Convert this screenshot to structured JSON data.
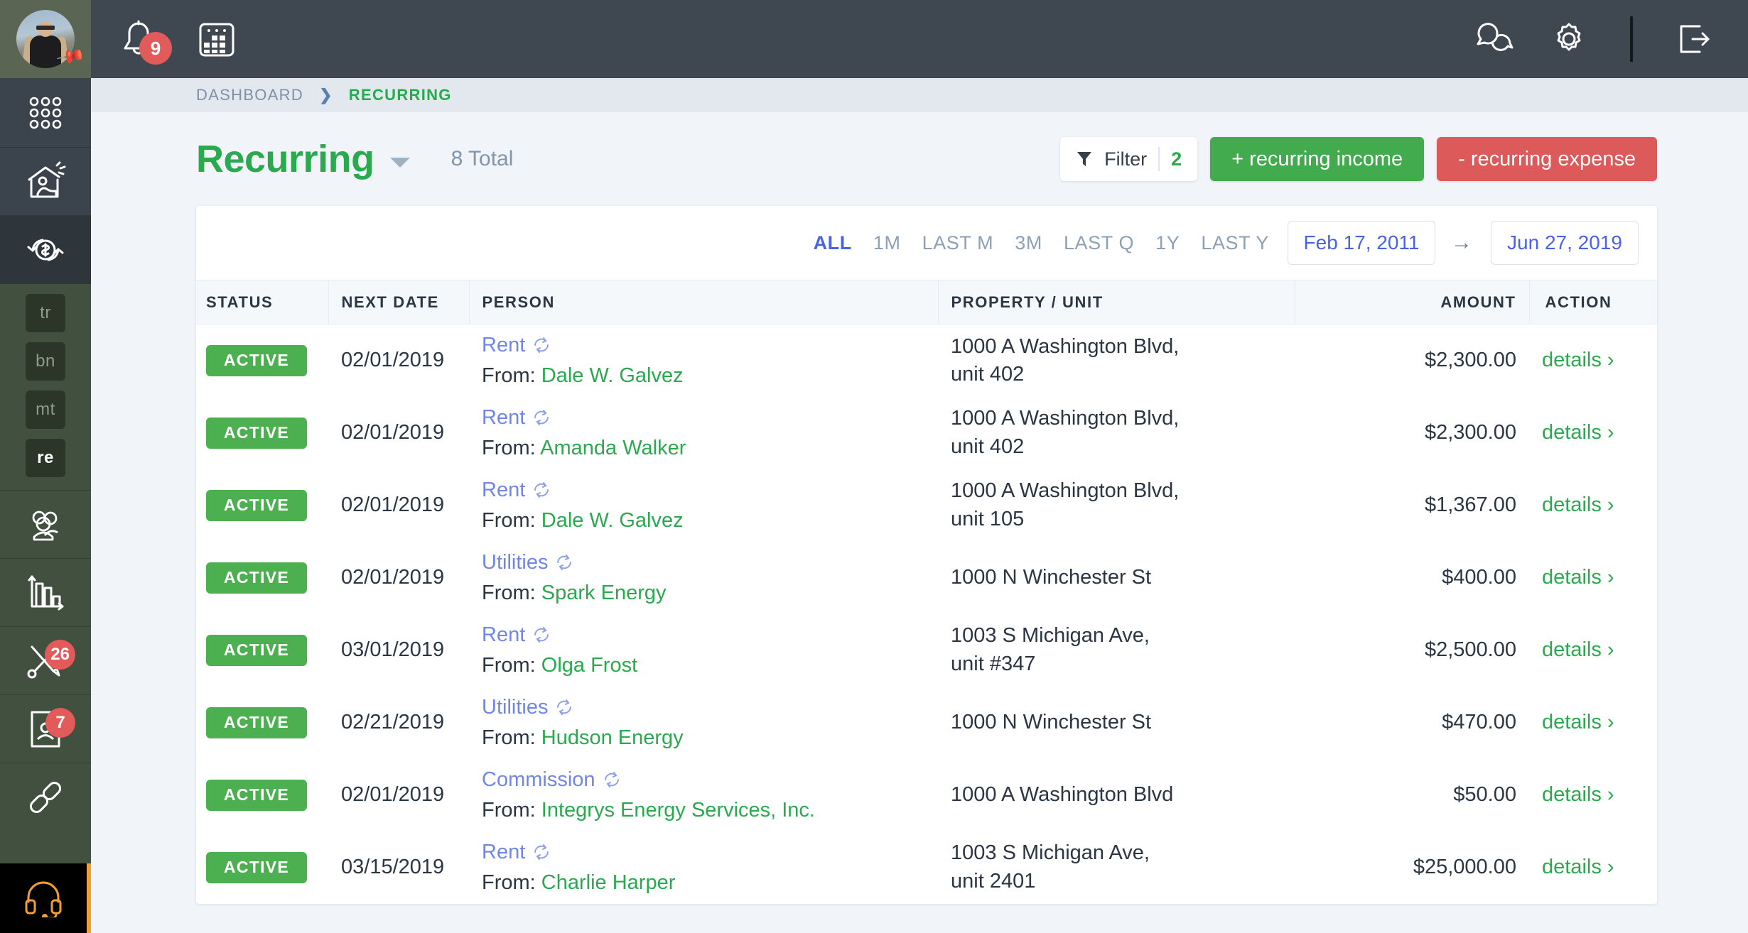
{
  "colors": {
    "brand_green": "#2aa94f",
    "accent_blue": "#4a62e8",
    "danger_red": "#dd5a5a",
    "sidebar_green": "#41503f",
    "topbar_dark": "#3f4850"
  },
  "sidebar": {
    "avatar_name": "user-avatar",
    "pin_icon": "pin-icon",
    "items": [
      {
        "name": "apps-grid-icon",
        "label": ""
      },
      {
        "name": "property-icon",
        "label": ""
      },
      {
        "name": "recurring-icon",
        "label": ""
      }
    ],
    "sub_items": [
      {
        "label": "tr",
        "active": false
      },
      {
        "label": "bn",
        "active": false
      },
      {
        "label": "mt",
        "active": false
      },
      {
        "label": "re",
        "active": true
      }
    ],
    "lower_items": [
      {
        "name": "people-icon",
        "badge": ""
      },
      {
        "name": "reports-bar-chart-icon",
        "badge": ""
      },
      {
        "name": "maintenance-tools-icon",
        "badge": "26"
      },
      {
        "name": "applications-doc-icon",
        "badge": "7"
      },
      {
        "name": "link-chain-icon",
        "badge": ""
      }
    ],
    "support": {
      "name": "headset-support-icon"
    }
  },
  "topbar": {
    "left_icons": [
      {
        "name": "notifications-bell-icon",
        "badge": "9"
      },
      {
        "name": "calendar-icon",
        "badge": ""
      }
    ],
    "right_icons": [
      {
        "name": "chat-bubbles-icon"
      },
      {
        "name": "gear-settings-icon"
      },
      {
        "name": "logout-icon"
      }
    ]
  },
  "breadcrumb": {
    "parent": "DASHBOARD",
    "separator": "❯",
    "current": "RECURRING"
  },
  "page": {
    "title": "Recurring",
    "total_label": "8 Total"
  },
  "actions": {
    "filter_label": "Filter",
    "filter_count": "2",
    "add_income": "+ recurring income",
    "add_expense": "- recurring expense"
  },
  "range": {
    "presets": [
      {
        "label": "ALL",
        "active": true
      },
      {
        "label": "1M",
        "active": false
      },
      {
        "label": "LAST M",
        "active": false
      },
      {
        "label": "3M",
        "active": false
      },
      {
        "label": "LAST Q",
        "active": false
      },
      {
        "label": "1Y",
        "active": false
      },
      {
        "label": "LAST Y",
        "active": false
      }
    ],
    "start_date": "Feb 17, 2011",
    "arrow": "→",
    "end_date": "Jun 27, 2019"
  },
  "table": {
    "columns": [
      "STATUS",
      "NEXT DATE",
      "PERSON",
      "PROPERTY / UNIT",
      "AMOUNT",
      "ACTION"
    ],
    "from_prefix": "From:",
    "details_label": "details",
    "details_chevron": "›",
    "rows": [
      {
        "status": "ACTIVE",
        "next_date": "02/01/2019",
        "type": "Rent",
        "person": "Dale W. Galvez",
        "property": "1000 A Washington Blvd,",
        "unit": "unit 402",
        "amount": "$2,300.00"
      },
      {
        "status": "ACTIVE",
        "next_date": "02/01/2019",
        "type": "Rent",
        "person": "Amanda Walker",
        "property": "1000 A Washington Blvd,",
        "unit": "unit 402",
        "amount": "$2,300.00"
      },
      {
        "status": "ACTIVE",
        "next_date": "02/01/2019",
        "type": "Rent",
        "person": "Dale W. Galvez",
        "property": "1000 A Washington Blvd,",
        "unit": "unit 105",
        "amount": "$1,367.00"
      },
      {
        "status": "ACTIVE",
        "next_date": "02/01/2019",
        "type": "Utilities",
        "person": "Spark Energy",
        "property": "1000 N Winchester St",
        "unit": "",
        "amount": "$400.00"
      },
      {
        "status": "ACTIVE",
        "next_date": "03/01/2019",
        "type": "Rent",
        "person": "Olga Frost",
        "property": "1003 S Michigan Ave,",
        "unit": "unit #347",
        "amount": "$2,500.00"
      },
      {
        "status": "ACTIVE",
        "next_date": "02/21/2019",
        "type": "Utilities",
        "person": "Hudson Energy",
        "property": "1000 N Winchester St",
        "unit": "",
        "amount": "$470.00"
      },
      {
        "status": "ACTIVE",
        "next_date": "02/01/2019",
        "type": "Commission",
        "person": "Integrys Energy Services, Inc.",
        "property": "1000 A Washington Blvd",
        "unit": "",
        "amount": "$50.00"
      },
      {
        "status": "ACTIVE",
        "next_date": "03/15/2019",
        "type": "Rent",
        "person": "Charlie Harper",
        "property": "1003 S Michigan Ave,",
        "unit": "unit 2401",
        "amount": "$25,000.00"
      }
    ]
  }
}
